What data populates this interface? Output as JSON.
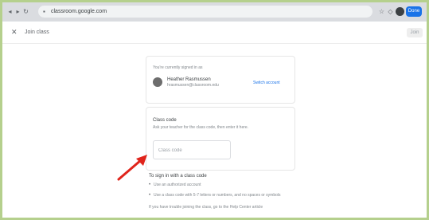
{
  "browser": {
    "url": "classroom.google.com",
    "profile_label": "Done"
  },
  "header": {
    "close_glyph": "✕",
    "title": "Join class",
    "join_label": "Join"
  },
  "account_card": {
    "heading": "You're currently signed in as",
    "user_name": "Heather Rasmussen",
    "user_email": "hrasmussen@classroom.edu",
    "switch_label": "Switch account"
  },
  "code_card": {
    "heading": "Class code",
    "subheading": "Ask your teacher for the class code, then enter it here.",
    "input_placeholder": "Class code"
  },
  "instructions": {
    "heading": "To sign in with a class code",
    "items": [
      "Use an authorized account",
      "Use a class code with 5-7 letters or numbers, and no spaces or symbols"
    ],
    "footer": "If you have trouble joining the class, go to the Help Center article"
  },
  "colors": {
    "frame_border": "#b5d08d",
    "accent": "#1a73e8",
    "arrow": "#e0241b"
  }
}
